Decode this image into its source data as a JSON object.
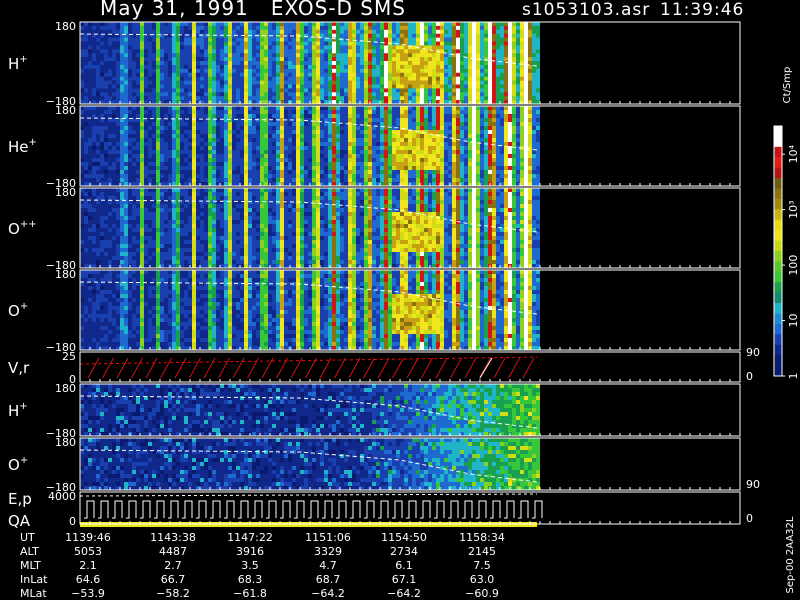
{
  "header": {
    "title": "May 31, 1991   EXOS-D SMS",
    "file": "s1053103.asr",
    "time": "11:39:46"
  },
  "colorbar": {
    "unit": "Ct/Smp",
    "ticks": [
      {
        "label": "1",
        "value": 1
      },
      {
        "label": "10",
        "value": 10
      },
      {
        "label": "100",
        "value": 100
      },
      {
        "label": "10³",
        "value": 1000
      },
      {
        "label": "10⁴",
        "value": 10000
      }
    ]
  },
  "side_note": "Sep-00 2AA32L",
  "chart_data": {
    "type": "heatmap",
    "panels": [
      {
        "label": "H",
        "sup": "+",
        "kind": "spectrogram",
        "ytop": "180",
        "ybot": "−180"
      },
      {
        "label": "He",
        "sup": "+",
        "kind": "spectrogram",
        "ytop": "180",
        "ybot": "−180"
      },
      {
        "label": "O",
        "sup": "++",
        "kind": "spectrogram",
        "ytop": "180",
        "ybot": "−180"
      },
      {
        "label": "O",
        "sup": "+",
        "kind": "spectrogram",
        "ytop": "180",
        "ybot": "−180"
      },
      {
        "label": "V,r",
        "sup": "",
        "kind": "line",
        "ytop": "25",
        "ybot": "0",
        "rtop": "90",
        "rbot": "0"
      },
      {
        "label": "H",
        "sup": "+",
        "kind": "spectrogram",
        "ytop": "180",
        "ybot": "−180"
      },
      {
        "label": "O",
        "sup": "+",
        "kind": "spectrogram",
        "ytop": "180",
        "ybot": "−180",
        "rbot": "90"
      },
      {
        "label": "E,p",
        "label2": "QA",
        "sup": "",
        "kind": "line",
        "ytop": "4000",
        "ybot": "0",
        "rbot": "0"
      }
    ],
    "table": {
      "rows": [
        {
          "label": "UT",
          "values": [
            "1139:46",
            "1143:38",
            "1147:22",
            "1151:06",
            "1154:50",
            "1158:34"
          ]
        },
        {
          "label": "ALT",
          "values": [
            "5053",
            "4487",
            "3916",
            "3329",
            "2734",
            "2145"
          ]
        },
        {
          "label": "MLT",
          "values": [
            "2.1",
            "2.7",
            "3.5",
            "4.7",
            "6.1",
            "7.5"
          ]
        },
        {
          "label": "InLat",
          "values": [
            "64.6",
            "66.7",
            "68.3",
            "68.7",
            "67.1",
            "63.0"
          ]
        },
        {
          "label": "MLat",
          "values": [
            "−53.9",
            "−58.2",
            "−61.8",
            "−64.2",
            "−64.2",
            "−60.9"
          ]
        }
      ]
    }
  }
}
